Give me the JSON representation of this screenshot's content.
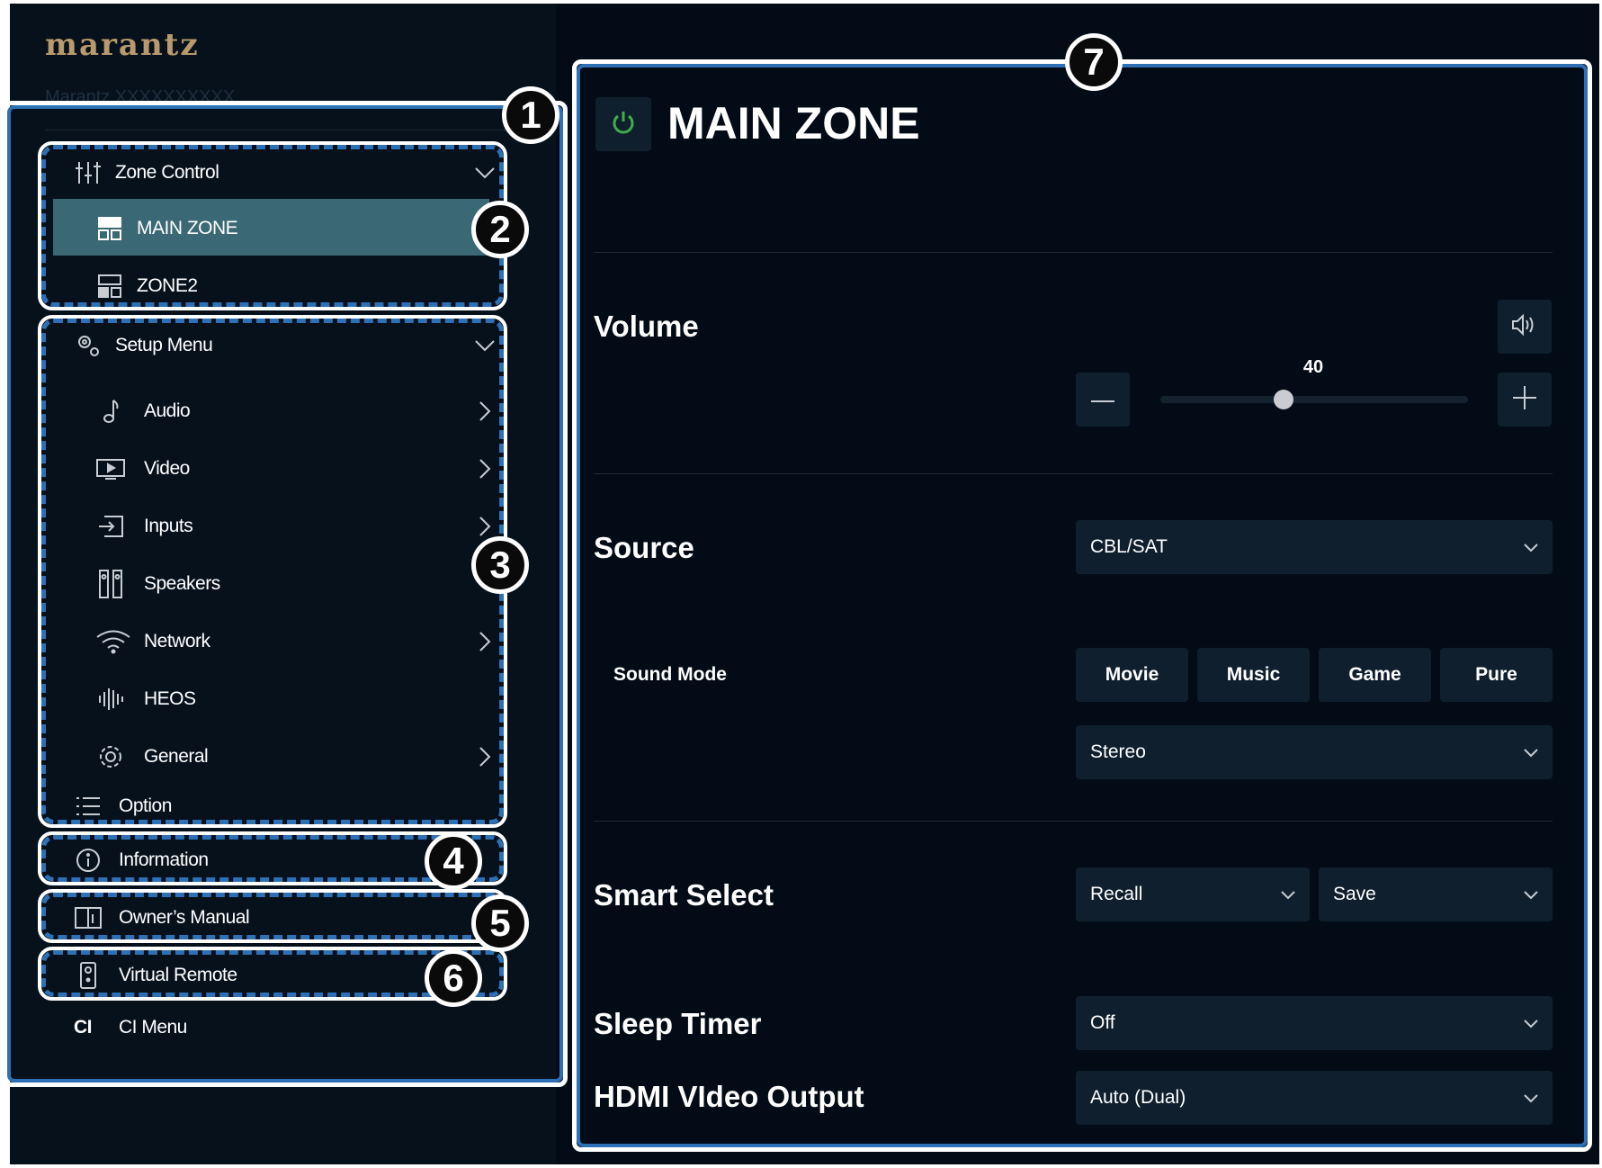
{
  "brand": {
    "logo": "marantz",
    "model": "Marantz XXXXXXXXXX"
  },
  "sidebar": {
    "zone_control": {
      "label": "Zone Control",
      "items": [
        {
          "label": "MAIN ZONE",
          "active": true
        },
        {
          "label": "ZONE2",
          "active": false
        }
      ]
    },
    "setup_menu": {
      "label": "Setup Menu",
      "items": [
        {
          "label": "Audio",
          "icon": "music-note-icon",
          "has_chevron": true
        },
        {
          "label": "Video",
          "icon": "video-icon",
          "has_chevron": true
        },
        {
          "label": "Inputs",
          "icon": "inputs-icon",
          "has_chevron": true
        },
        {
          "label": "Speakers",
          "icon": "speakers-icon",
          "has_chevron": false
        },
        {
          "label": "Network",
          "icon": "wifi-icon",
          "has_chevron": true
        },
        {
          "label": "HEOS",
          "icon": "heos-icon",
          "has_chevron": false
        },
        {
          "label": "General",
          "icon": "gear-icon",
          "has_chevron": true
        }
      ]
    },
    "option": {
      "label": "Option"
    },
    "information": {
      "label": "Information"
    },
    "owners_manual": {
      "label": "Owner’s Manual"
    },
    "virtual_remote": {
      "label": "Virtual Remote"
    },
    "ci_menu": {
      "icon_text": "CI",
      "label": "CI Menu"
    }
  },
  "callouts": [
    "1",
    "2",
    "3",
    "4",
    "5",
    "6",
    "7"
  ],
  "main": {
    "title": "MAIN ZONE",
    "volume": {
      "label": "Volume",
      "value": "40",
      "level_fraction": 0.4
    },
    "source": {
      "label": "Source",
      "selected": "CBL/SAT"
    },
    "sound_mode": {
      "label": "Sound Mode",
      "buttons": [
        "Movie",
        "Music",
        "Game",
        "Pure"
      ],
      "selected": "Stereo"
    },
    "smart_select": {
      "label": "Smart Select",
      "recall": "Recall",
      "save": "Save"
    },
    "sleep_timer": {
      "label": "Sleep Timer",
      "selected": "Off"
    },
    "hdmi_output": {
      "label": "HDMI VIdeo Output",
      "selected": "Auto (Dual)"
    }
  },
  "colors": {
    "active_row": "#3a6874",
    "callout_blue": "#2e70b6",
    "power_green": "#3fae49",
    "logo": "#b89a6d"
  }
}
